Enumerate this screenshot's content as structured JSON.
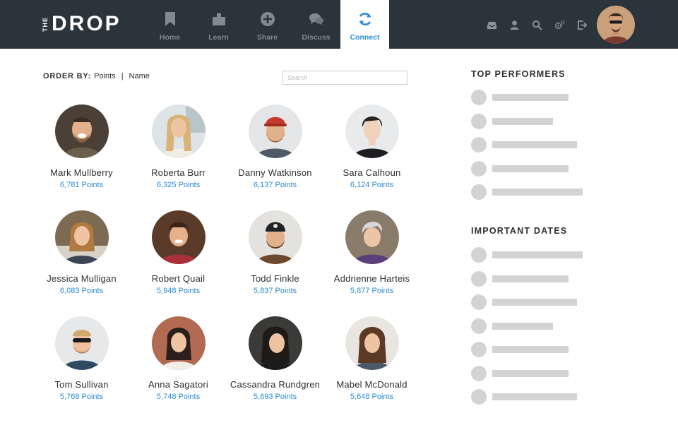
{
  "brand": {
    "the": "THE",
    "name": "DROP"
  },
  "nav": [
    {
      "label": "Home",
      "icon": "bookmark-icon"
    },
    {
      "label": "Learn",
      "icon": "puzzle-icon"
    },
    {
      "label": "Share",
      "icon": "plus-circle-icon"
    },
    {
      "label": "Discuss",
      "icon": "chat-bubbles-icon"
    },
    {
      "label": "Connect",
      "icon": "sync-icon",
      "active": true
    }
  ],
  "utility_icons": [
    "inbox-icon",
    "user-icon",
    "search-icon",
    "settings-icon",
    "logout-icon"
  ],
  "order": {
    "label": "ORDER BY:",
    "options": [
      "Points",
      "Name"
    ],
    "separator": "|"
  },
  "search": {
    "placeholder": "Search",
    "value": ""
  },
  "people": [
    {
      "name": "Mark Mullberry",
      "points": "6,781 Points"
    },
    {
      "name": "Roberta Burr",
      "points": "6,325 Points"
    },
    {
      "name": "Danny Watkinson",
      "points": "6,137 Points"
    },
    {
      "name": "Sara Calhoun",
      "points": "6,124 Points"
    },
    {
      "name": "Jessica Mulligan",
      "points": "6,083 Points"
    },
    {
      "name": "Robert Quail",
      "points": "5,948 Points"
    },
    {
      "name": "Todd Finkle",
      "points": "5,837 Points"
    },
    {
      "name": "Addrienne Harteis",
      "points": "5,877 Points"
    },
    {
      "name": "Tom Sullivan",
      "points": "5,768 Points"
    },
    {
      "name": "Anna Sagatori",
      "points": "5,748 Points"
    },
    {
      "name": "Cassandra Rundgren",
      "points": "5,693 Points"
    },
    {
      "name": "Mabel McDonald",
      "points": "5,648 Points"
    }
  ],
  "sidebar": {
    "top_performers_title": "TOP PERFORMERS",
    "important_dates_title": "IMPORTANT DATES"
  },
  "colors": {
    "header_bg": "#2b343b",
    "accent": "#2b8cd6",
    "nav_inactive": "#7f8a93",
    "placeholder_gray": "#d3d3d3"
  }
}
